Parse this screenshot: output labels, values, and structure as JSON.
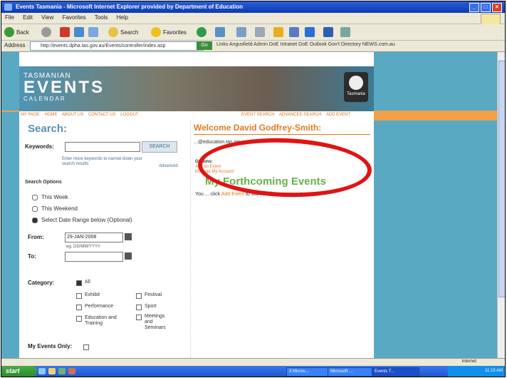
{
  "window": {
    "title": "Events Tasmania - Microsoft Internet Explorer provided by Department of Education"
  },
  "menu": [
    "File",
    "Edit",
    "View",
    "Favorites",
    "Tools",
    "Help"
  ],
  "toolbar": {
    "back": "Back",
    "search": "Search",
    "favorites": "Favorites"
  },
  "address": {
    "label": "Address",
    "url": "http://events.dpha.tas.gov.au/Events/controller/index.asp",
    "go": "Go",
    "links": "Links  Angusfield Admin  DoE Intranet  DoE Outlook  Gov't Directory  NEWS.com.au"
  },
  "banner": {
    "tasmanian": "TASMANIAN",
    "events": "EVENTS",
    "calendar": "CALENDAR",
    "gov": "Tasmania"
  },
  "nav": {
    "left": [
      "MY PAGE",
      "HOME",
      "ABOUT US",
      "CONTACT US",
      "LOGOUT"
    ],
    "right": [
      "EVENT SEARCH",
      "ADVANCED SEARCH",
      "ADD EVENT"
    ]
  },
  "search": {
    "heading": "Search:",
    "keywords_label": "Keywords:",
    "button": "SEARCH",
    "hint": "Enter more keywords to narrow down your search results",
    "advanced": "Advanced",
    "options_label": "Search Options",
    "radios": [
      "This Week",
      "This Weekend",
      "Select Date Range below (Optional)"
    ],
    "from_label": "From:",
    "from_value": "29-JAN-2008",
    "format_hint": "eg. DD/MM/YYYY",
    "to_label": "To:",
    "category_label": "Category:",
    "all": "All",
    "cats": [
      "Exhibit",
      "Festival",
      "Performance",
      "Sport",
      "Education and Training",
      "Meetings and Seminars"
    ],
    "my_events_label": "My Events Only:"
  },
  "welcome": {
    "heading": "Welcome David Godfrey-Smith:",
    "email": "...@education.tas.gov.au",
    "options_label": "Options:",
    "options": [
      "Add an Event",
      "Manage My Account"
    ]
  },
  "forthcoming": {
    "heading": "My Forthcoming Events",
    "text_pre": "You ... click",
    "link": "Add Event",
    "text_post": "to start adding your events."
  },
  "status": {
    "zone": "Internet"
  },
  "taskbar": {
    "start": "start",
    "tasks": [
      "3 Micros...",
      "Microsoft ...",
      "Events T...",
      ""
    ],
    "clock": "11:15 AM"
  }
}
